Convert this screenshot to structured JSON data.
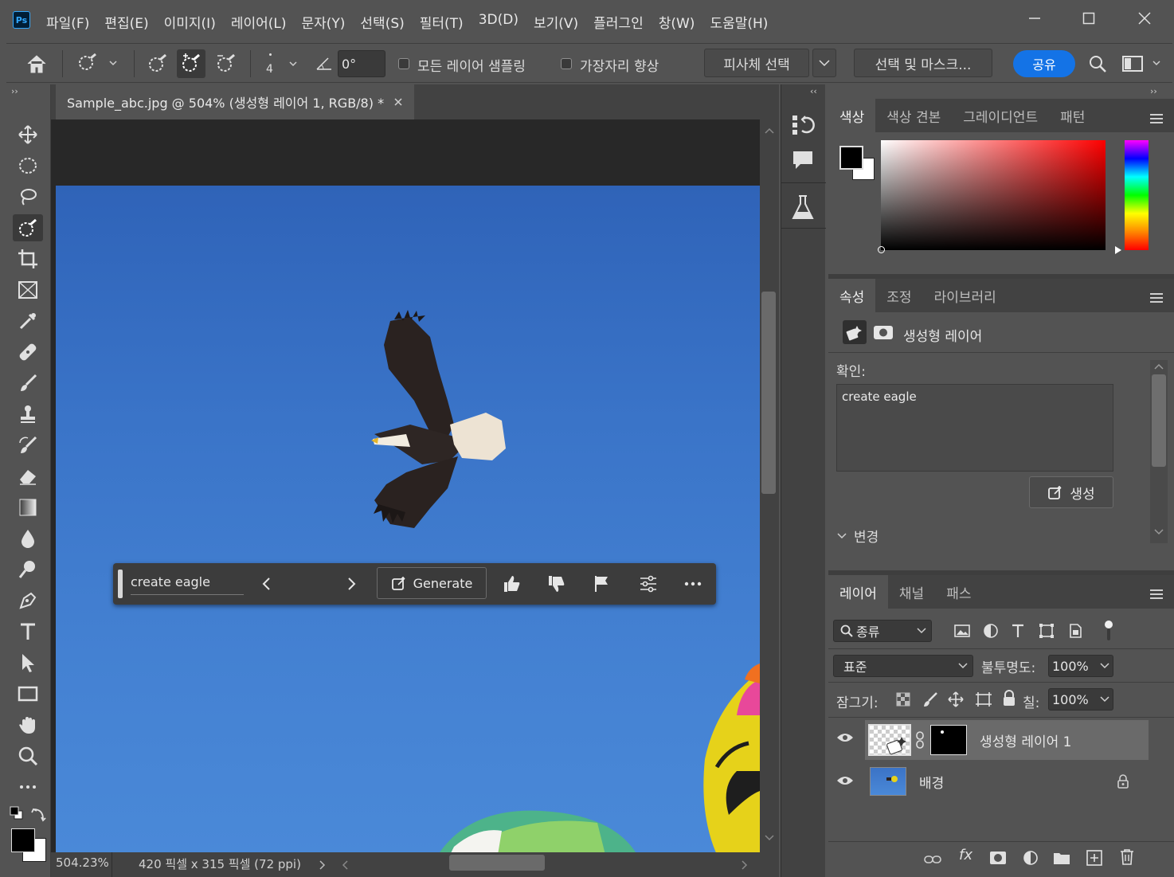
{
  "app": {
    "logo": "Ps"
  },
  "menu": [
    "파일(F)",
    "편집(E)",
    "이미지(I)",
    "레이어(L)",
    "문자(Y)",
    "선택(S)",
    "필터(T)",
    "3D(D)",
    "보기(V)",
    "플러그인",
    "창(W)",
    "도움말(H)"
  ],
  "options_bar": {
    "brush_size": "4",
    "angle": "0°",
    "sample_all_layers": "모든 레이어 샘플링",
    "enhance_edge": "가장자리 향상",
    "select_subject": "피사체 선택",
    "select_and_mask": "선택 및 마스크...",
    "share": "공유"
  },
  "document": {
    "tab_title": "Sample_abc.jpg @ 504% (생성형 레이어 1, RGB/8) *",
    "zoom": "504.23%",
    "info": "420 픽셀 x 315 픽셀 (72 ppi)"
  },
  "context_bar": {
    "prompt": "create eagle",
    "generate": "Generate"
  },
  "color_panel": {
    "tabs": [
      "색상",
      "색상 견본",
      "그레이디언트",
      "패턴"
    ],
    "active_tab": "색상",
    "foreground": "#000000",
    "background": "#ffffff",
    "hue_color": "#ff0000"
  },
  "properties_panel": {
    "tabs": [
      "속성",
      "조정",
      "라이브러리"
    ],
    "layer_type": "생성형 레이어",
    "prompt_label": "확인:",
    "prompt_text": "create eagle",
    "generate_btn": "생성",
    "variations_label": "변경"
  },
  "layers_panel": {
    "tabs": [
      "레이어",
      "채널",
      "패스"
    ],
    "filter_kind": "종류",
    "blend_mode": "표준",
    "opacity_label": "불투명도:",
    "opacity": "100%",
    "lock_label": "잠그기:",
    "fill_label": "칠:",
    "fill": "100%",
    "layers": [
      {
        "name": "생성형 레이어 1",
        "selected": true
      },
      {
        "name": "배경",
        "locked": true
      }
    ]
  }
}
